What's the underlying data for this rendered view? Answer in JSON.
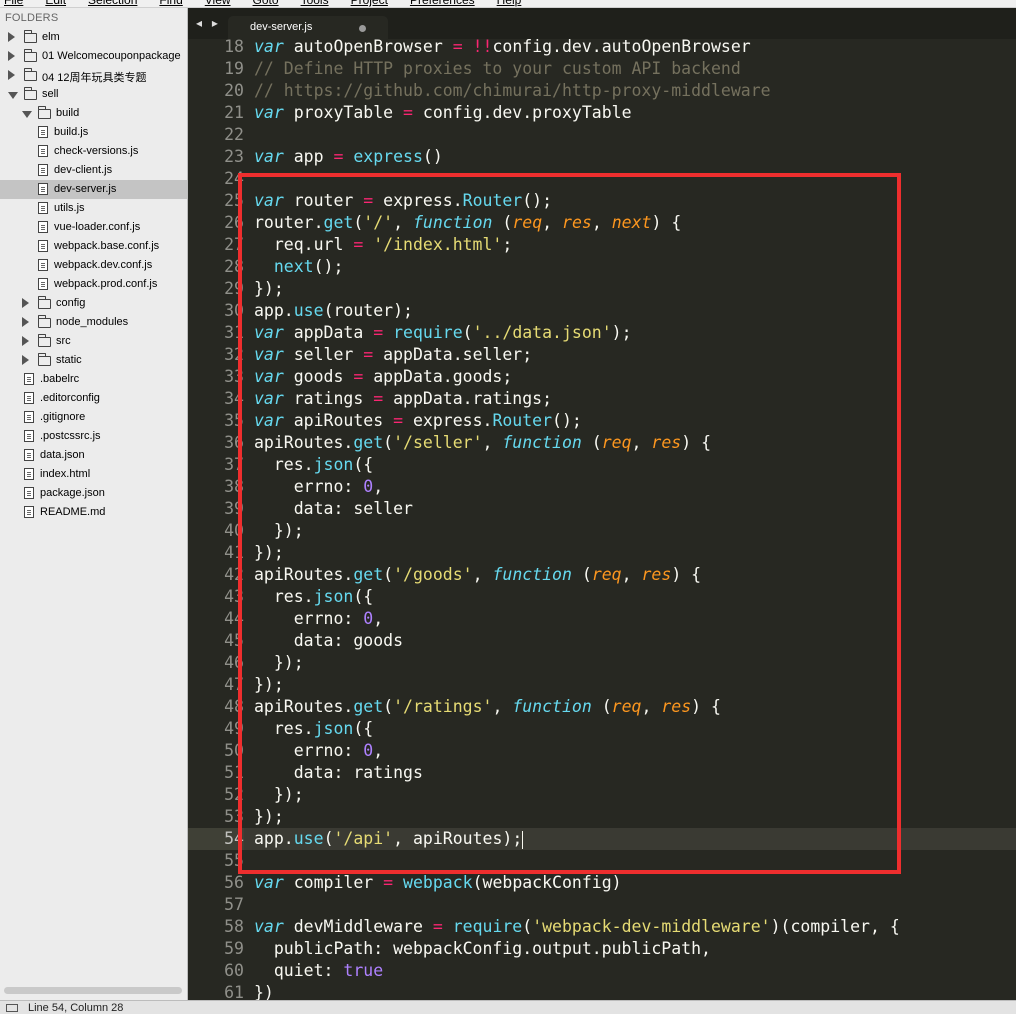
{
  "menu": [
    "File",
    "Edit",
    "Selection",
    "Find",
    "View",
    "Goto",
    "Tools",
    "Project",
    "Preferences",
    "Help"
  ],
  "sidebar": {
    "title": "FOLDERS",
    "items": [
      {
        "label": "elm",
        "kind": "folder",
        "depth": 0,
        "expanded": false
      },
      {
        "label": "01 Welcomecouponpackage",
        "kind": "folder",
        "depth": 0,
        "expanded": false
      },
      {
        "label": "04 12周年玩具类专题",
        "kind": "folder",
        "depth": 0,
        "expanded": false
      },
      {
        "label": "sell",
        "kind": "folder",
        "depth": 0,
        "expanded": true
      },
      {
        "label": "build",
        "kind": "folder",
        "depth": 1,
        "expanded": true
      },
      {
        "label": "build.js",
        "kind": "file",
        "depth": 2
      },
      {
        "label": "check-versions.js",
        "kind": "file",
        "depth": 2
      },
      {
        "label": "dev-client.js",
        "kind": "file",
        "depth": 2
      },
      {
        "label": "dev-server.js",
        "kind": "file",
        "depth": 2,
        "selected": true
      },
      {
        "label": "utils.js",
        "kind": "file",
        "depth": 2
      },
      {
        "label": "vue-loader.conf.js",
        "kind": "file",
        "depth": 2
      },
      {
        "label": "webpack.base.conf.js",
        "kind": "file",
        "depth": 2
      },
      {
        "label": "webpack.dev.conf.js",
        "kind": "file",
        "depth": 2
      },
      {
        "label": "webpack.prod.conf.js",
        "kind": "file",
        "depth": 2
      },
      {
        "label": "config",
        "kind": "folder",
        "depth": 1,
        "expanded": false
      },
      {
        "label": "node_modules",
        "kind": "folder",
        "depth": 1,
        "expanded": false
      },
      {
        "label": "src",
        "kind": "folder",
        "depth": 1,
        "expanded": false
      },
      {
        "label": "static",
        "kind": "folder",
        "depth": 1,
        "expanded": false
      },
      {
        "label": ".babelrc",
        "kind": "file",
        "depth": 1
      },
      {
        "label": ".editorconfig",
        "kind": "file",
        "depth": 1
      },
      {
        "label": ".gitignore",
        "kind": "file",
        "depth": 1
      },
      {
        "label": ".postcssrc.js",
        "kind": "file",
        "depth": 1
      },
      {
        "label": "data.json",
        "kind": "file",
        "depth": 1
      },
      {
        "label": "index.html",
        "kind": "file",
        "depth": 1
      },
      {
        "label": "package.json",
        "kind": "file",
        "depth": 1
      },
      {
        "label": "README.md",
        "kind": "file",
        "depth": 1
      }
    ]
  },
  "tabs": {
    "nav": "◂ ▸",
    "active_label": "dev-server.js"
  },
  "editor": {
    "current_line": 54,
    "lines": [
      {
        "n": 18,
        "t": [
          [
            "k",
            "var"
          ],
          [
            "",
            ""
          ],
          [
            "",
            " autoOpenBrowser "
          ],
          [
            "o",
            "="
          ],
          [
            "",
            " "
          ],
          [
            "o",
            "!!"
          ],
          [
            "",
            "config.dev.autoOpenBrowser"
          ]
        ]
      },
      {
        "n": 19,
        "t": [
          [
            "c",
            "// Define HTTP proxies to your custom API backend"
          ]
        ]
      },
      {
        "n": 20,
        "t": [
          [
            "c",
            "// https://github.com/chimurai/http-proxy-middleware"
          ]
        ]
      },
      {
        "n": 21,
        "t": [
          [
            "k",
            "var"
          ],
          [
            "",
            " proxyTable "
          ],
          [
            "o",
            "="
          ],
          [
            "",
            " config.dev.proxyTable"
          ]
        ]
      },
      {
        "n": 22,
        "t": []
      },
      {
        "n": 23,
        "t": [
          [
            "k",
            "var"
          ],
          [
            "",
            " app "
          ],
          [
            "o",
            "="
          ],
          [
            "",
            " "
          ],
          [
            "f",
            "express"
          ],
          [
            "",
            "()"
          ]
        ]
      },
      {
        "n": 24,
        "t": []
      },
      {
        "n": 25,
        "t": [
          [
            "k",
            "var"
          ],
          [
            "",
            " router "
          ],
          [
            "o",
            "="
          ],
          [
            "",
            " express."
          ],
          [
            "f",
            "Router"
          ],
          [
            "",
            "();"
          ]
        ]
      },
      {
        "n": 26,
        "t": [
          [
            "",
            "router."
          ],
          [
            "f",
            "get"
          ],
          [
            "",
            "("
          ],
          [
            "s",
            "'/'"
          ],
          [
            ", "
          ],
          [
            "k",
            "function"
          ],
          [
            "",
            " ("
          ],
          [
            "p",
            "req"
          ],
          [
            "",
            ", "
          ],
          [
            "p",
            "res"
          ],
          [
            "",
            ", "
          ],
          [
            "p",
            "next"
          ],
          [
            "",
            ") {"
          ]
        ]
      },
      {
        "n": 27,
        "t": [
          [
            "",
            "  req.url "
          ],
          [
            "o",
            "="
          ],
          [
            "",
            " "
          ],
          [
            "s",
            "'/index.html'"
          ],
          [
            "",
            ";"
          ]
        ]
      },
      {
        "n": 28,
        "t": [
          [
            "",
            "  "
          ],
          [
            "f",
            "next"
          ],
          [
            "",
            "();"
          ]
        ]
      },
      {
        "n": 29,
        "t": [
          [
            "",
            "});"
          ]
        ]
      },
      {
        "n": 30,
        "t": [
          [
            "",
            "app."
          ],
          [
            "f",
            "use"
          ],
          [
            "",
            "(router);"
          ]
        ]
      },
      {
        "n": 31,
        "t": [
          [
            "k",
            "var"
          ],
          [
            "",
            " appData "
          ],
          [
            "o",
            "="
          ],
          [
            "",
            " "
          ],
          [
            "f",
            "require"
          ],
          [
            "",
            "("
          ],
          [
            "s",
            "'../data.json'"
          ],
          [
            "",
            ");"
          ]
        ]
      },
      {
        "n": 32,
        "t": [
          [
            "k",
            "var"
          ],
          [
            "",
            " seller "
          ],
          [
            "o",
            "="
          ],
          [
            "",
            " appData.seller;"
          ]
        ]
      },
      {
        "n": 33,
        "t": [
          [
            "k",
            "var"
          ],
          [
            "",
            " goods "
          ],
          [
            "o",
            "="
          ],
          [
            "",
            " appData.goods;"
          ]
        ]
      },
      {
        "n": 34,
        "t": [
          [
            "k",
            "var"
          ],
          [
            "",
            " ratings "
          ],
          [
            "o",
            "="
          ],
          [
            "",
            " appData.ratings;"
          ]
        ]
      },
      {
        "n": 35,
        "t": [
          [
            "k",
            "var"
          ],
          [
            "",
            " apiRoutes "
          ],
          [
            "o",
            "="
          ],
          [
            "",
            " express."
          ],
          [
            "f",
            "Router"
          ],
          [
            "",
            "();"
          ]
        ]
      },
      {
        "n": 36,
        "t": [
          [
            "",
            "apiRoutes."
          ],
          [
            "f",
            "get"
          ],
          [
            "",
            "("
          ],
          [
            "s",
            "'/seller'"
          ],
          [
            "",
            ", "
          ],
          [
            "k",
            "function"
          ],
          [
            "",
            " ("
          ],
          [
            "p",
            "req"
          ],
          [
            "",
            ", "
          ],
          [
            "p",
            "res"
          ],
          [
            "",
            ") {"
          ]
        ]
      },
      {
        "n": 37,
        "t": [
          [
            "",
            "  res."
          ],
          [
            "f",
            "json"
          ],
          [
            "",
            "({"
          ]
        ]
      },
      {
        "n": 38,
        "t": [
          [
            "",
            "    errno: "
          ],
          [
            "n",
            "0"
          ],
          [
            "",
            ","
          ]
        ]
      },
      {
        "n": 39,
        "t": [
          [
            "",
            "    data: seller"
          ]
        ]
      },
      {
        "n": 40,
        "t": [
          [
            "",
            "  });"
          ]
        ]
      },
      {
        "n": 41,
        "t": [
          [
            "",
            "});"
          ]
        ]
      },
      {
        "n": 42,
        "t": [
          [
            "",
            "apiRoutes."
          ],
          [
            "f",
            "get"
          ],
          [
            "",
            "("
          ],
          [
            "s",
            "'/goods'"
          ],
          [
            "",
            ", "
          ],
          [
            "k",
            "function"
          ],
          [
            "",
            " ("
          ],
          [
            "p",
            "req"
          ],
          [
            "",
            ", "
          ],
          [
            "p",
            "res"
          ],
          [
            "",
            ") {"
          ]
        ]
      },
      {
        "n": 43,
        "t": [
          [
            "",
            "  res."
          ],
          [
            "f",
            "json"
          ],
          [
            "",
            "({"
          ]
        ]
      },
      {
        "n": 44,
        "t": [
          [
            "",
            "    errno: "
          ],
          [
            "n",
            "0"
          ],
          [
            "",
            ","
          ]
        ]
      },
      {
        "n": 45,
        "t": [
          [
            "",
            "    data: goods"
          ]
        ]
      },
      {
        "n": 46,
        "t": [
          [
            "",
            "  });"
          ]
        ]
      },
      {
        "n": 47,
        "t": [
          [
            "",
            "});"
          ]
        ]
      },
      {
        "n": 48,
        "t": [
          [
            "",
            "apiRoutes."
          ],
          [
            "f",
            "get"
          ],
          [
            "",
            "("
          ],
          [
            "s",
            "'/ratings'"
          ],
          [
            "",
            ", "
          ],
          [
            "k",
            "function"
          ],
          [
            "",
            " ("
          ],
          [
            "p",
            "req"
          ],
          [
            "",
            ", "
          ],
          [
            "p",
            "res"
          ],
          [
            "",
            ") {"
          ]
        ]
      },
      {
        "n": 49,
        "t": [
          [
            "",
            "  res."
          ],
          [
            "f",
            "json"
          ],
          [
            "",
            "({"
          ]
        ]
      },
      {
        "n": 50,
        "t": [
          [
            "",
            "    errno: "
          ],
          [
            "n",
            "0"
          ],
          [
            "",
            ","
          ]
        ]
      },
      {
        "n": 51,
        "t": [
          [
            "",
            "    data: ratings"
          ]
        ]
      },
      {
        "n": 52,
        "t": [
          [
            "",
            "  });"
          ]
        ]
      },
      {
        "n": 53,
        "t": [
          [
            "",
            "});"
          ]
        ]
      },
      {
        "n": 54,
        "t": [
          [
            "",
            "app."
          ],
          [
            "f",
            "use"
          ],
          [
            "",
            "("
          ],
          [
            "s",
            "'/api'"
          ],
          [
            "",
            ", apiRoutes);"
          ]
        ]
      },
      {
        "n": 55,
        "t": []
      },
      {
        "n": 56,
        "t": [
          [
            "k",
            "var"
          ],
          [
            "",
            " compiler "
          ],
          [
            "o",
            "="
          ],
          [
            "",
            " "
          ],
          [
            "f",
            "webpack"
          ],
          [
            "",
            "(webpackConfig)"
          ]
        ]
      },
      {
        "n": 57,
        "t": []
      },
      {
        "n": 58,
        "t": [
          [
            "k",
            "var"
          ],
          [
            "",
            " devMiddleware "
          ],
          [
            "o",
            "="
          ],
          [
            "",
            " "
          ],
          [
            "f",
            "require"
          ],
          [
            "",
            "("
          ],
          [
            "s",
            "'webpack-dev-middleware'"
          ],
          [
            "",
            ")(compiler, {"
          ]
        ]
      },
      {
        "n": 59,
        "t": [
          [
            "",
            "  publicPath: webpackConfig.output.publicPath,"
          ]
        ]
      },
      {
        "n": 60,
        "t": [
          [
            "",
            "  quiet: "
          ],
          [
            "n",
            "true"
          ]
        ]
      },
      {
        "n": 61,
        "t": [
          [
            "",
            "})"
          ]
        ]
      }
    ]
  },
  "status": {
    "text": "Line 54, Column 28"
  },
  "colors": {
    "annotation_border": "#ee2e2e",
    "editor_bg": "#272822"
  }
}
